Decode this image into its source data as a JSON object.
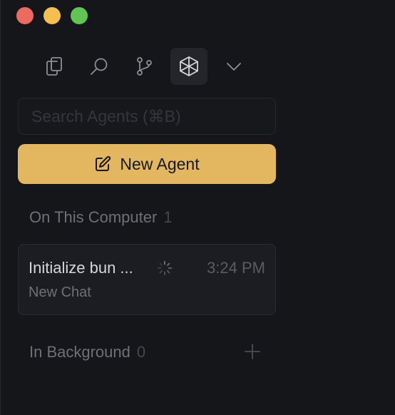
{
  "window": {
    "controls": [
      "close",
      "minimize",
      "zoom"
    ]
  },
  "toolbar": {
    "buttons": [
      {
        "icon": "files-icon",
        "active": false
      },
      {
        "icon": "search-icon",
        "active": false
      },
      {
        "icon": "source-control-icon",
        "active": false
      },
      {
        "icon": "agents-cube-icon",
        "active": true
      },
      {
        "icon": "chevron-down-icon",
        "active": false
      }
    ]
  },
  "search": {
    "placeholder": "Search Agents (⌘B)",
    "value": ""
  },
  "new_agent": {
    "label": "New Agent",
    "icon": "edit-icon"
  },
  "sections": {
    "on_this_computer": {
      "title": "On This Computer",
      "count": "1",
      "agents": [
        {
          "title": "Initialize bun ...",
          "time": "3:24 PM",
          "subtitle": "New Chat",
          "status": "running"
        }
      ]
    },
    "in_background": {
      "title": "In Background",
      "count": "0",
      "add_icon": "plus-icon"
    }
  },
  "colors": {
    "background": "#15161a",
    "accent": "#e2b760",
    "card": "#1c1d22",
    "muted_text": "#6e7077"
  }
}
